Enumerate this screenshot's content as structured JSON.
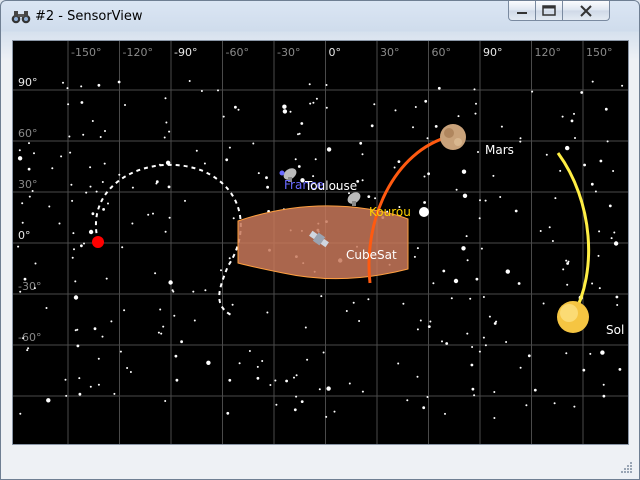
{
  "window": {
    "title": "#2 - SensorView",
    "icon": "binoculars-icon",
    "controls": [
      "minimize-icon",
      "maximize-icon",
      "close-icon"
    ]
  },
  "sky_map": {
    "longitude_labels": [
      "-150°",
      "-120°",
      "-90°",
      "-60°",
      "-30°",
      "0°",
      "30°",
      "60°",
      "90°",
      "120°",
      "150°"
    ],
    "latitude_labels": [
      "90°",
      "60°",
      "30°",
      "0°",
      "-30°",
      "-60°"
    ],
    "objects": {
      "mars": "Mars",
      "sun": "Sol",
      "cubesat": "CubeSat",
      "kourou": "Kourou",
      "toulouse": "Toulouse",
      "france": "France"
    },
    "colors": {
      "background": "#000000",
      "grid": "#4a4a4a",
      "stars": "#ffffff",
      "mars_track": "#ff5a10",
      "sun_track": "#ffee44",
      "sensor_fill": "#c8785a",
      "sensor_edge": "#ffa040",
      "red_marker": "#ff0000",
      "kourou_label": "#ffd000",
      "france_label": "#6a6aff"
    }
  }
}
